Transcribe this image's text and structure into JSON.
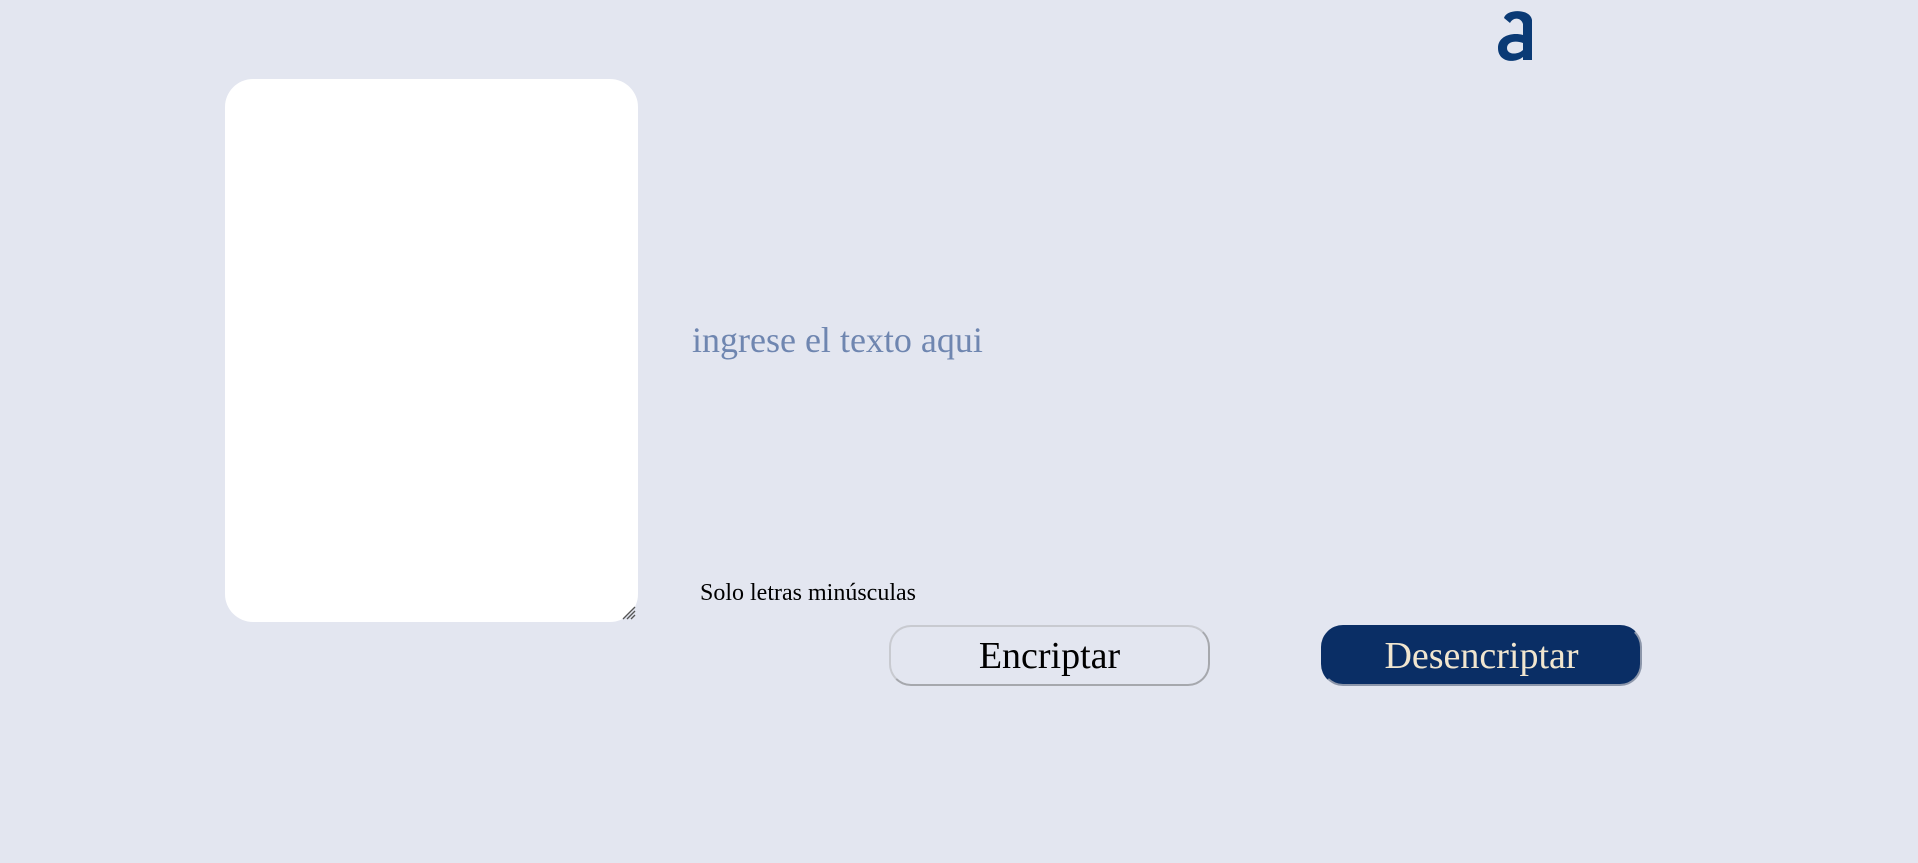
{
  "brand": {
    "logo_icon": "alura-a-logo-icon",
    "logo_color": "#0a3a75"
  },
  "output_panel": {
    "background": "#ffffff"
  },
  "input": {
    "placeholder": "ingrese el texto aqui",
    "value": ""
  },
  "hint": {
    "text": "Solo letras minúsculas"
  },
  "actions": {
    "encrypt_label": "Encriptar",
    "decrypt_label": "Desencriptar",
    "decrypt_color": "#0a2e65"
  },
  "theme": {
    "background": "#e3e6f0"
  }
}
